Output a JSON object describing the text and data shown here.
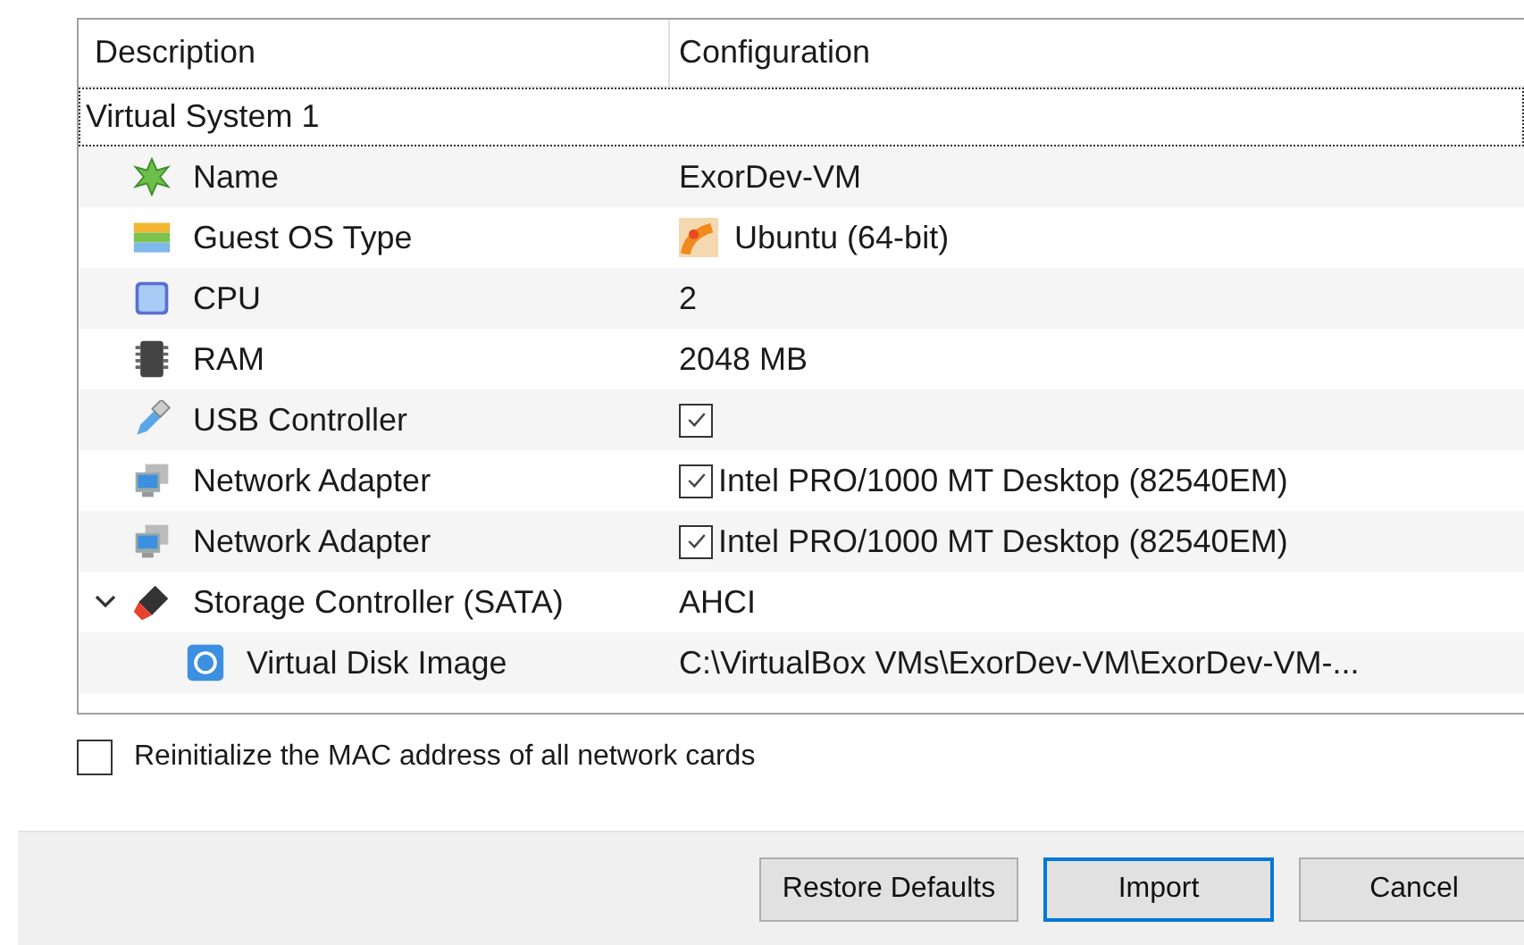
{
  "table": {
    "columns": [
      "Description",
      "Configuration"
    ],
    "group": {
      "label": "Virtual System 1",
      "selected": true
    },
    "rows": [
      {
        "kind": "text",
        "description": "Name",
        "configuration": "ExorDev-VM"
      },
      {
        "kind": "os",
        "description": "Guest OS Type",
        "configuration": "Ubuntu (64-bit)"
      },
      {
        "kind": "text",
        "description": "CPU",
        "configuration": "2"
      },
      {
        "kind": "text",
        "description": "RAM",
        "configuration": "2048 MB"
      },
      {
        "kind": "checkbox",
        "description": "USB Controller",
        "checked": true
      },
      {
        "kind": "checkbox",
        "description": "Network Adapter",
        "checked": true,
        "configuration": "Intel PRO/1000 MT Desktop (82540EM)"
      },
      {
        "kind": "checkbox",
        "description": "Network Adapter",
        "checked": true,
        "configuration": "Intel PRO/1000 MT Desktop (82540EM)"
      },
      {
        "kind": "text",
        "description": "Storage Controller (SATA)",
        "configuration": "AHCI",
        "expanded": true,
        "children": [
          {
            "description": "Virtual Disk Image",
            "configuration": "C:\\VirtualBox VMs\\ExorDev-VM\\ExorDev-VM-..."
          }
        ]
      }
    ]
  },
  "reinitialize_mac": {
    "label": "Reinitialize the MAC address of all network cards",
    "checked": false
  },
  "buttons": [
    {
      "label": "Restore Defaults",
      "default": false
    },
    {
      "label": "Import",
      "default": true
    },
    {
      "label": "Cancel",
      "default": false
    }
  ]
}
